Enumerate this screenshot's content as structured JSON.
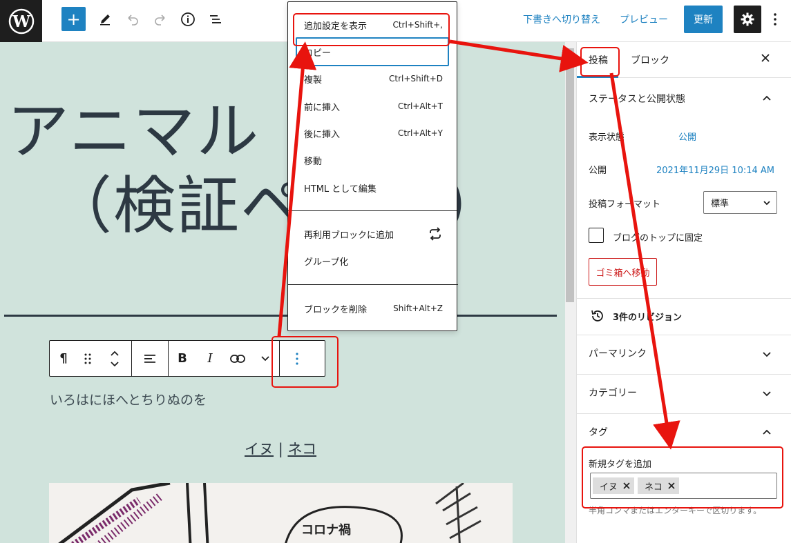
{
  "toolbar": {
    "add_label": "+",
    "switch_draft": "下書きへ切り替え",
    "preview": "プレビュー",
    "update": "更新"
  },
  "post": {
    "title_line1": "アニマル",
    "title_line2": "（検証ペ",
    "title_line2_end": "）",
    "paragraph": "いろはにほへとちりぬのを",
    "tag_links": [
      "イヌ",
      "ネコ"
    ],
    "tag_separator": "|"
  },
  "block_toolbar": {
    "paragraph_icon": "pilcrow-icon",
    "bold": "B",
    "italic": "I"
  },
  "menu": {
    "items": [
      {
        "label": "追加設定を表示",
        "shortcut": "Ctrl+Shift+,"
      },
      {
        "label": "コピー",
        "shortcut": ""
      },
      {
        "label": "複製",
        "shortcut": "Ctrl+Shift+D"
      },
      {
        "label": "前に挿入",
        "shortcut": "Ctrl+Alt+T"
      },
      {
        "label": "後に挿入",
        "shortcut": "Ctrl+Alt+Y"
      },
      {
        "label": "移動",
        "shortcut": ""
      },
      {
        "label": "HTML として編集",
        "shortcut": ""
      },
      {
        "label": "再利用ブロックに追加",
        "shortcut": ""
      },
      {
        "label": "グループ化",
        "shortcut": ""
      },
      {
        "label": "ブロックを削除",
        "shortcut": "Shift+Alt+Z"
      }
    ]
  },
  "sidebar": {
    "tab_post": "投稿",
    "tab_block": "ブロック",
    "status_panel": "ステータスと公開状態",
    "visibility_label": "表示状態",
    "visibility_value": "公開",
    "publish_label": "公開",
    "publish_value": "2021年11月29日 10:14 AM",
    "format_label": "投稿フォーマット",
    "format_value": "標準",
    "sticky_label": "ブログのトップに固定",
    "trash_label": "ゴミ箱へ移動",
    "revisions": "3件のリビジョン",
    "permalink": "パーマリンク",
    "categories": "カテゴリー",
    "tags_panel": "タグ",
    "add_tag_label": "新規タグを追加",
    "tokens": [
      "イヌ",
      "ネコ"
    ],
    "help_text": "半角コンマまたはエンターキーで区切ります。"
  },
  "colors": {
    "accent": "#1e82c1",
    "canvas_bg": "#d0e3dc",
    "annotation": "#e8140e",
    "danger": "#cc1818"
  }
}
